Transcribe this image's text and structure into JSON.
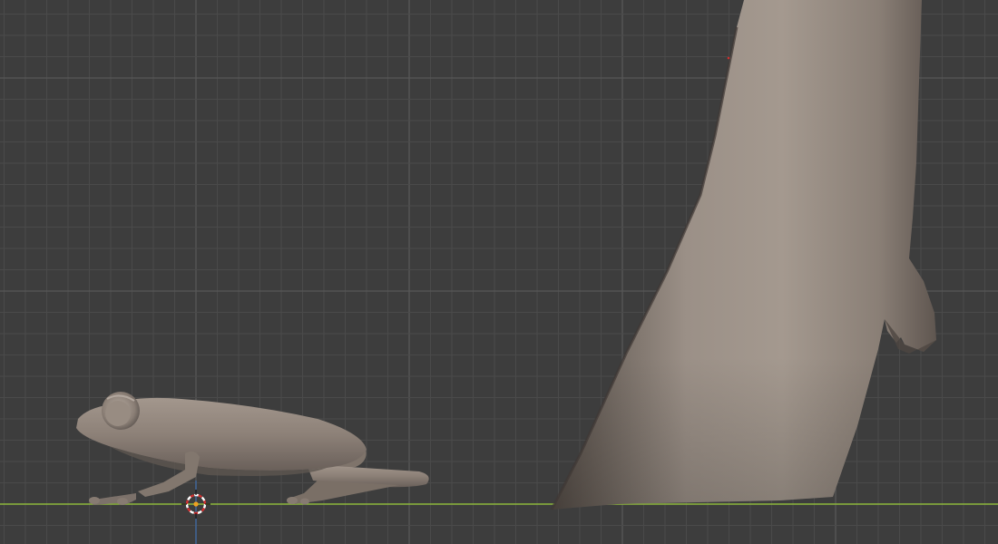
{
  "viewport": {
    "background_color": "#3d3d3d",
    "grid_minor_color": "#4a4a4a",
    "grid_major_color": "#575757",
    "x_axis_color": "#8bb63b",
    "z_axis_color": "#3b6fb6",
    "projection": "orthographic-side"
  },
  "scene_objects": [
    {
      "name": "frog",
      "kind": "mesh",
      "material_color": "#8e8278"
    },
    {
      "name": "leg",
      "kind": "mesh",
      "material_color": "#8e8278"
    }
  ],
  "cursor_3d": {
    "icon": "crosshair-icon",
    "ring_colors": [
      "#d12f2f",
      "#ffffff"
    ]
  },
  "origin_point": {
    "icon": "dot-icon",
    "color": "#f0a020"
  }
}
